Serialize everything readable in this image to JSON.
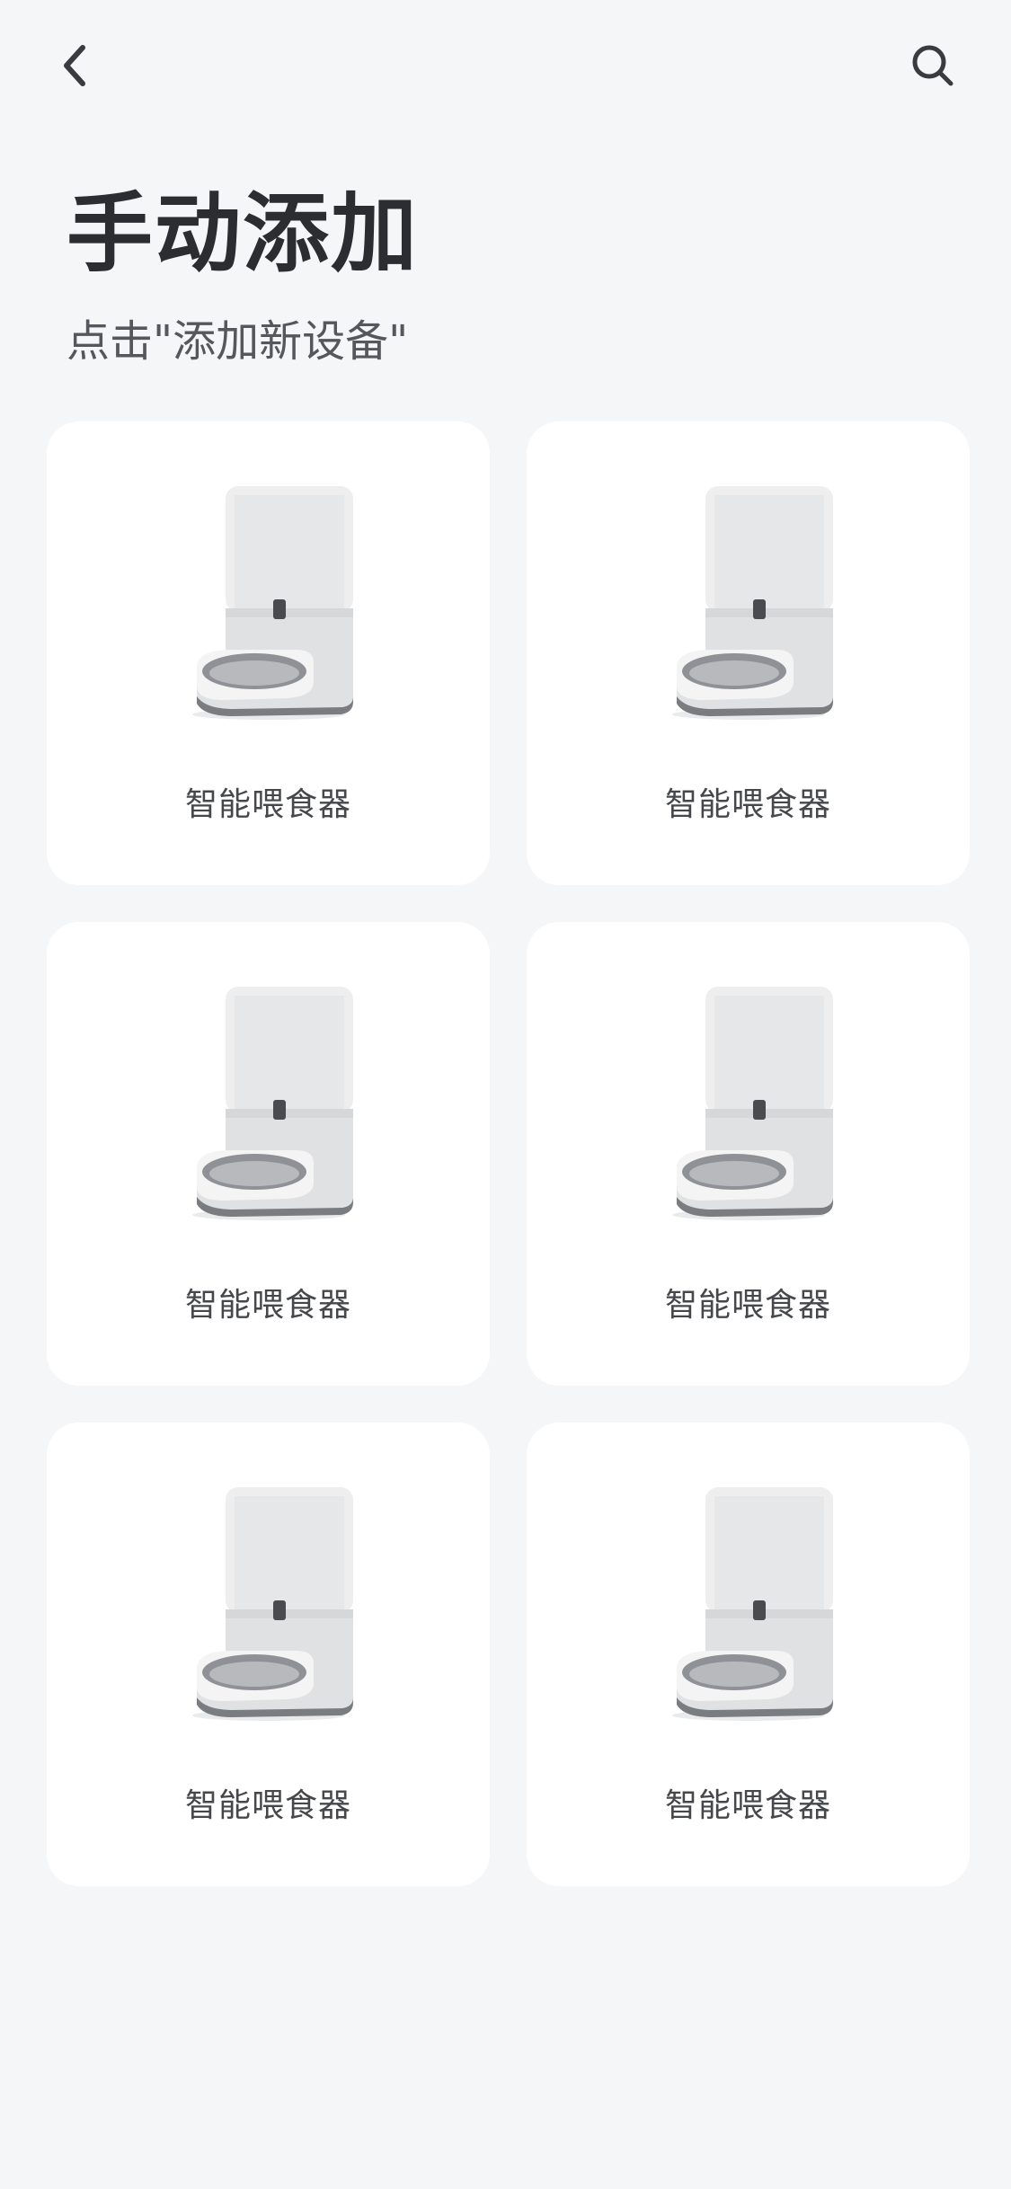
{
  "header": {
    "back_icon": "chevron-left-icon",
    "search_icon": "search-icon",
    "title": "手动添加",
    "subtitle": "点击\"添加新设备\""
  },
  "devices": [
    {
      "label": "智能喂食器",
      "image": "pet-feeder-image"
    },
    {
      "label": "智能喂食器",
      "image": "pet-feeder-image"
    },
    {
      "label": "智能喂食器",
      "image": "pet-feeder-image"
    },
    {
      "label": "智能喂食器",
      "image": "pet-feeder-image"
    },
    {
      "label": "智能喂食器",
      "image": "pet-feeder-image"
    },
    {
      "label": "智能喂食器",
      "image": "pet-feeder-image"
    }
  ],
  "colors": {
    "background": "#f5f6f8",
    "card": "#ffffff",
    "title": "#2c2d30",
    "text": "#45474b"
  }
}
